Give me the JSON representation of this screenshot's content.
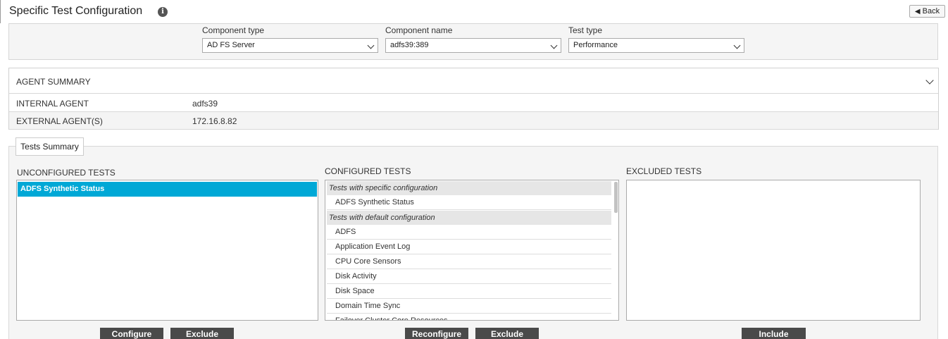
{
  "header": {
    "title": "Specific Test Configuration",
    "info_icon": "i",
    "back_label": "Back"
  },
  "filters": {
    "component_type": {
      "label": "Component type",
      "value": "AD FS Server"
    },
    "component_name": {
      "label": "Component name",
      "value": "adfs39:389"
    },
    "test_type": {
      "label": "Test type",
      "value": "Performance"
    }
  },
  "agent_summary": {
    "title": "AGENT SUMMARY",
    "rows": [
      {
        "key": "INTERNAL AGENT",
        "value": "adfs39"
      },
      {
        "key": "EXTERNAL AGENT(S)",
        "value": "172.16.8.82"
      }
    ]
  },
  "tests_summary": {
    "legend": "Tests Summary",
    "unconfigured": {
      "label": "UNCONFIGURED TESTS",
      "items": [
        "ADFS Synthetic Status"
      ],
      "selected_color": "#00a8d6"
    },
    "configured": {
      "label": "CONFIGURED TESTS",
      "specific_header": "Tests with specific configuration",
      "specific_items": [
        "ADFS Synthetic Status"
      ],
      "default_header": "Tests with default configuration",
      "default_items": [
        "ADFS",
        "Application Event Log",
        "CPU Core Sensors",
        "Disk Activity",
        "Disk Space",
        "Domain Time Sync",
        "Failover Cluster Core Resources"
      ]
    },
    "excluded": {
      "label": "EXCLUDED TESTS",
      "items": []
    }
  },
  "buttons": {
    "configure": "Configure",
    "exclude_unconfigured": "Exclude",
    "reconfigure": "Reconfigure",
    "exclude_configured": "Exclude",
    "include": "Include"
  }
}
